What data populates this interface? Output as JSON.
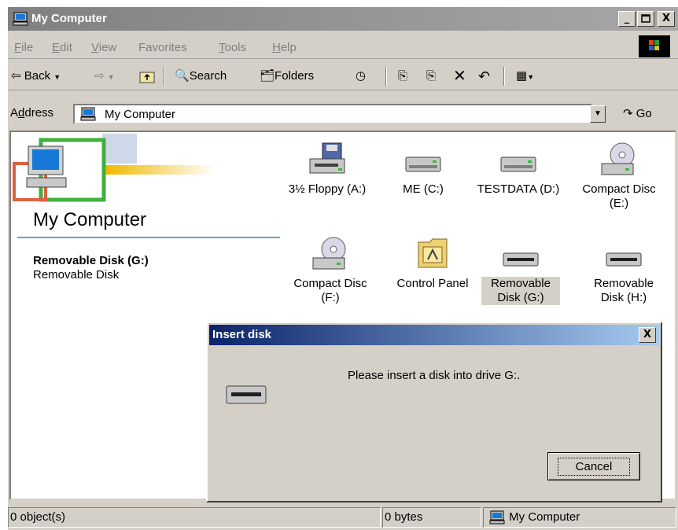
{
  "window": {
    "title": "My Computer",
    "minimize": "_",
    "maximize": "□",
    "close": "X"
  },
  "menu": {
    "items": [
      {
        "first": "F",
        "rest": "ile"
      },
      {
        "first": "E",
        "rest": "dit"
      },
      {
        "first": "V",
        "rest": "iew"
      },
      {
        "first": "Fa",
        "rest": "vorites",
        "underline_index": 1
      },
      {
        "first": "T",
        "rest": "ools"
      },
      {
        "first": "H",
        "rest": "elp"
      }
    ]
  },
  "toolbar": {
    "back": "Back",
    "search": "Search",
    "folders": "Folders"
  },
  "address": {
    "label_pre": "A",
    "label_u": "d",
    "label_post": "dress",
    "value": "My Computer",
    "go": "Go"
  },
  "sidebar": {
    "title": "My Computer",
    "selected_name": "Removable Disk (G:)",
    "selected_type": "Removable Disk"
  },
  "items": [
    {
      "label": "3½ Floppy (A:)",
      "icon": "floppy-drive-icon"
    },
    {
      "label": "ME (C:)",
      "icon": "hard-drive-icon"
    },
    {
      "label": "TESTDATA (D:)",
      "icon": "hard-drive-icon"
    },
    {
      "label": "Compact Disc (E:)",
      "icon": "cd-drive-icon"
    },
    {
      "label": "Compact Disc (F:)",
      "icon": "cd-drive-icon"
    },
    {
      "label": "Control Panel",
      "icon": "control-panel-icon"
    },
    {
      "label": "Removable Disk (G:)",
      "icon": "removable-drive-icon",
      "selected": true
    },
    {
      "label": "Removable Disk (H:)",
      "icon": "removable-drive-icon"
    }
  ],
  "dialog": {
    "title": "Insert disk",
    "close": "X",
    "message": "Please insert a disk into drive G:.",
    "cancel": "Cancel"
  },
  "status": {
    "objects": "0 object(s)",
    "size": "0 bytes",
    "zone": "My Computer"
  },
  "colors": {
    "face": "#d4d0c8",
    "title_inactive": "#808080",
    "title_active": "#0a246a",
    "banner_line": "#7a96c8"
  }
}
